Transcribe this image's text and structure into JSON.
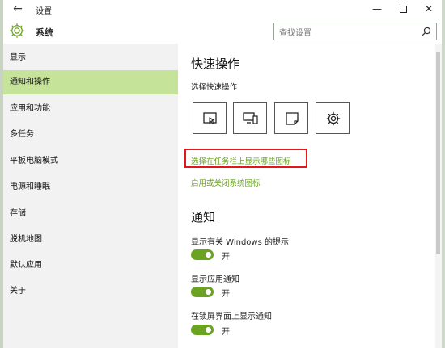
{
  "window": {
    "title": "设置",
    "minimize_glyph": "—",
    "close_glyph": "✕",
    "back_glyph": "←"
  },
  "header": {
    "section_title": "系统",
    "search_placeholder": "查找设置"
  },
  "sidebar": {
    "items": [
      {
        "label": "显示",
        "active": false
      },
      {
        "label": "通知和操作",
        "active": true
      },
      {
        "label": "应用和功能",
        "active": false
      },
      {
        "label": "多任务",
        "active": false
      },
      {
        "label": "平板电脑模式",
        "active": false
      },
      {
        "label": "电源和睡眠",
        "active": false
      },
      {
        "label": "存储",
        "active": false
      },
      {
        "label": "脱机地图",
        "active": false
      },
      {
        "label": "默认应用",
        "active": false
      },
      {
        "label": "关于",
        "active": false
      }
    ]
  },
  "main": {
    "quick_actions_title": "快速操作",
    "quick_actions_subtitle": "选择快速操作",
    "quick_action_icons": [
      "tablet-mode-icon",
      "connect-icon",
      "note-icon",
      "settings-gear-icon"
    ],
    "link_taskbar_icons": "选择在任务栏上显示哪些图标",
    "link_system_icons": "启用或关闭系统图标",
    "notifications_title": "通知",
    "toggles": [
      {
        "label": "显示有关 Windows 的提示",
        "state_text": "开",
        "on": true
      },
      {
        "label": "显示应用通知",
        "state_text": "开",
        "on": true
      },
      {
        "label": "在锁屏界面上显示通知",
        "state_text": "开",
        "on": true
      }
    ]
  },
  "colors": {
    "accent_green": "#6aa322",
    "active_nav": "#c6e39a",
    "highlight_red": "#e6141b"
  }
}
